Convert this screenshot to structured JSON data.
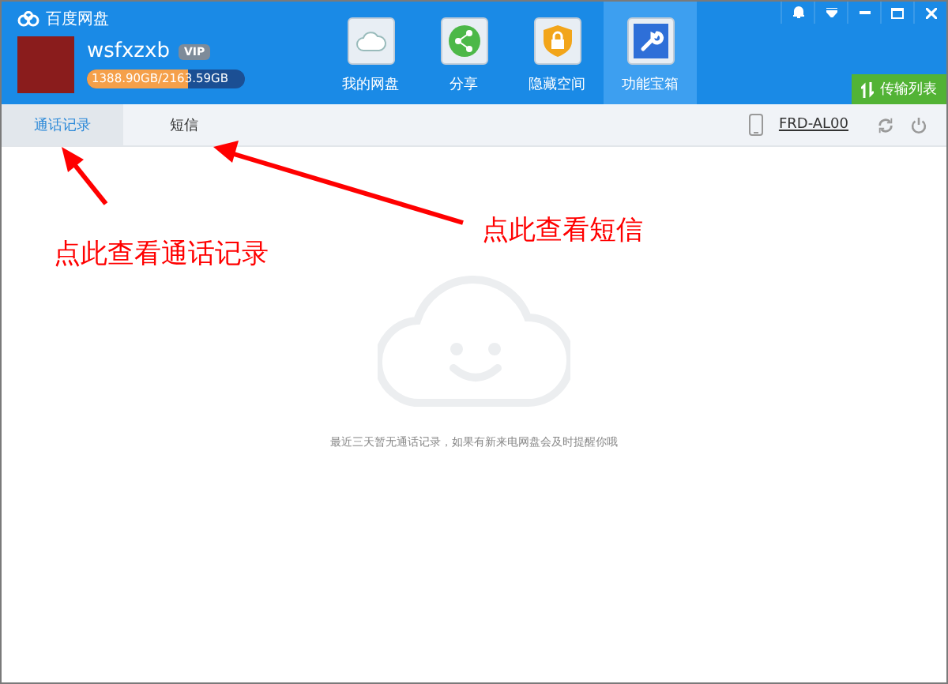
{
  "app": {
    "title": "百度网盘"
  },
  "user": {
    "name": "wsfxzxb",
    "badge": "VIP",
    "quota": "1388.90GB/2163.59GB",
    "level": 0.642
  },
  "nav": [
    {
      "label": "我的网盘",
      "selected": false,
      "kind": "cloud"
    },
    {
      "label": "分享",
      "selected": false,
      "kind": "share"
    },
    {
      "label": "隐藏空间",
      "selected": false,
      "kind": "lock"
    },
    {
      "label": "功能宝箱",
      "selected": true,
      "kind": "tools"
    }
  ],
  "transfer_button": "传输列表",
  "tabs": [
    {
      "label": "通话记录",
      "selected": true
    },
    {
      "label": "短信",
      "selected": false
    }
  ],
  "device": "FRD-AL00",
  "empty_message": "最近三天暂无通话记录，如果有新来电网盘会及时提醒你哦",
  "annotations": [
    "点此查看通话记录",
    "点此查看短信"
  ]
}
